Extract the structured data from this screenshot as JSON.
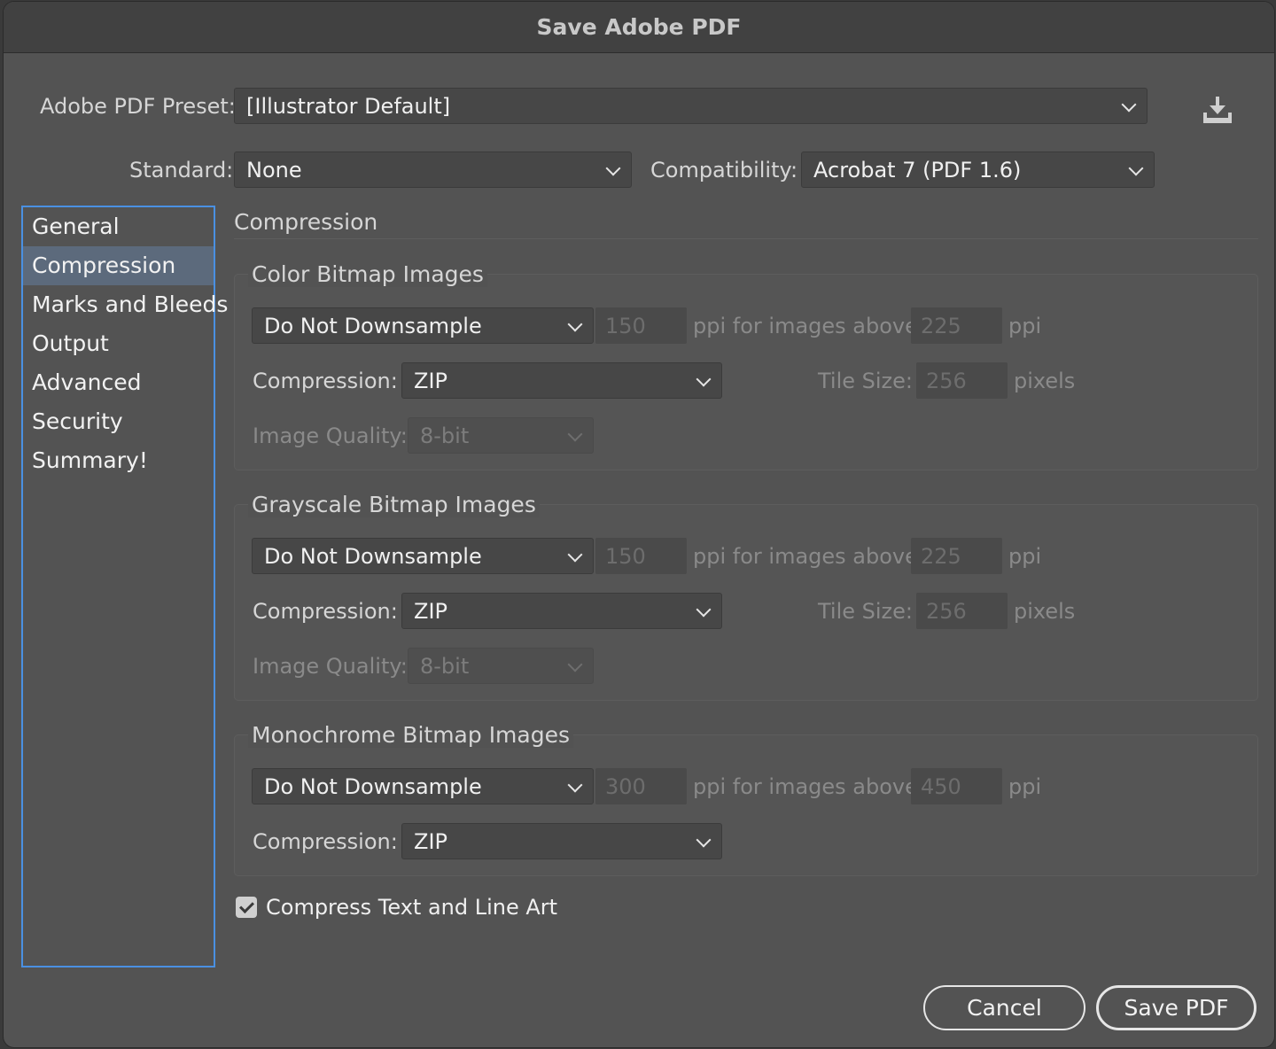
{
  "window": {
    "title": "Save Adobe PDF"
  },
  "preset": {
    "label": "Adobe PDF Preset:",
    "value": "[Illustrator Default]",
    "save_icon": "save-preset-icon"
  },
  "standard": {
    "label": "Standard:",
    "value": "None"
  },
  "compatibility": {
    "label": "Compatibility:",
    "value": "Acrobat 7 (PDF 1.6)"
  },
  "sidebar": {
    "items": [
      {
        "label": "General"
      },
      {
        "label": "Compression"
      },
      {
        "label": "Marks and Bleeds"
      },
      {
        "label": "Output"
      },
      {
        "label": "Advanced"
      },
      {
        "label": "Security"
      },
      {
        "label": "Summary!"
      }
    ],
    "active_index": 1
  },
  "main": {
    "title": "Compression",
    "color": {
      "title": "Color Bitmap Images",
      "downsample": "Do Not Downsample",
      "ppi": "150",
      "ppi_above_label": "ppi for images above",
      "above": "225",
      "ppi_unit": "ppi",
      "compression_label": "Compression:",
      "compression": "ZIP",
      "tile_label": "Tile Size:",
      "tile": "256",
      "tile_unit": "pixels",
      "quality_label": "Image Quality:",
      "quality": "8-bit"
    },
    "gray": {
      "title": "Grayscale Bitmap Images",
      "downsample": "Do Not Downsample",
      "ppi": "150",
      "ppi_above_label": "ppi for images above",
      "above": "225",
      "ppi_unit": "ppi",
      "compression_label": "Compression:",
      "compression": "ZIP",
      "tile_label": "Tile Size:",
      "tile": "256",
      "tile_unit": "pixels",
      "quality_label": "Image Quality:",
      "quality": "8-bit"
    },
    "mono": {
      "title": "Monochrome Bitmap Images",
      "downsample": "Do Not Downsample",
      "ppi": "300",
      "ppi_above_label": "ppi for images above",
      "above": "450",
      "ppi_unit": "ppi",
      "compression_label": "Compression:",
      "compression": "ZIP"
    },
    "compress_text": {
      "label": "Compress Text and Line Art",
      "checked": true
    }
  },
  "buttons": {
    "cancel": "Cancel",
    "save": "Save PDF"
  }
}
